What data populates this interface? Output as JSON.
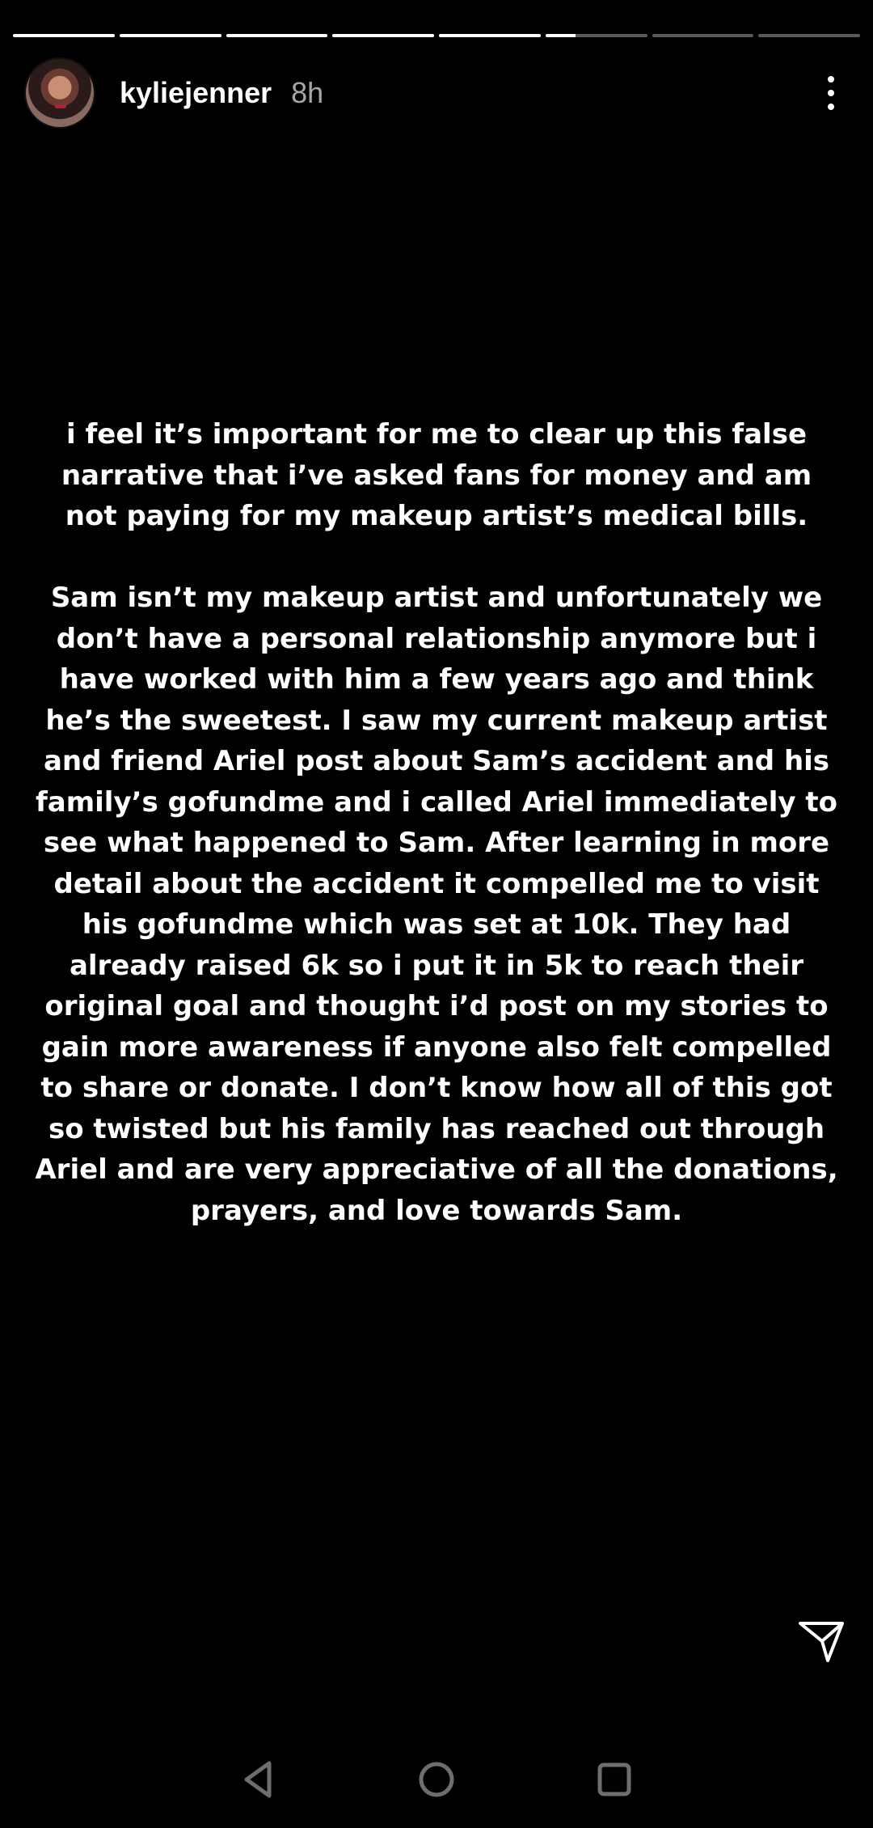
{
  "story": {
    "segments_total": 8,
    "segments_viewed": 5,
    "current_segment_progress": 0.3,
    "username": "kyliejenner",
    "time_ago": "8h",
    "paragraph_1": "i feel it’s important for me to clear up this false narrative that i’ve asked fans for money and am not paying for my makeup artist’s medical bills.",
    "paragraph_2": "Sam isn’t my makeup artist and unfortunately we don’t have a personal relationship anymore but i have worked with him a few years ago and think he’s the sweetest. I saw my current makeup artist and friend Ariel post about Sam’s accident and his family’s gofundme and i called Ariel immediately to see what happened to Sam. After learning in more detail about the accident it compelled me to visit his gofundme which was set at 10k. They had already raised 6k so i put it in 5k to reach their original goal and thought i’d post on my stories to gain more awareness if anyone also felt compelled to share or donate. I don’t know how all of this got so twisted but his family has reached out through Ariel and are very appreciative of all the donations, prayers, and love towards Sam."
  },
  "icons": {
    "more": "more-vertical-icon",
    "send": "send-icon",
    "back": "nav-back-icon",
    "home": "nav-home-icon",
    "recents": "nav-recents-icon"
  },
  "colors": {
    "background": "#000000",
    "text": "#ffffff",
    "timestamp": "#a6a6a6",
    "progress_track": "#595959",
    "nav_icons": "#6e6e6e"
  }
}
